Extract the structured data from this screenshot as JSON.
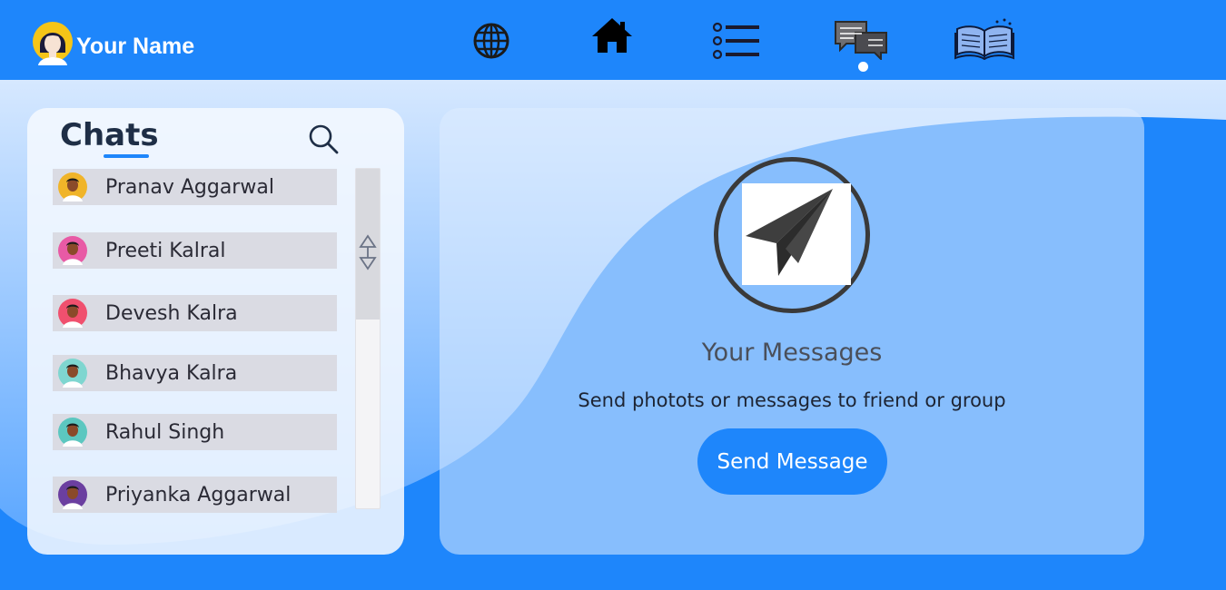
{
  "header": {
    "user_name": "Your Name",
    "nav": [
      {
        "icon": "globe-icon"
      },
      {
        "icon": "home-icon"
      },
      {
        "icon": "list-icon"
      },
      {
        "icon": "chat-bubbles-icon",
        "active": true
      },
      {
        "icon": "book-icon"
      }
    ]
  },
  "chats": {
    "title": "Chats",
    "search_icon": "search-icon",
    "items": [
      {
        "name": "Pranav Aggarwal",
        "avatar_color": "#f0b429"
      },
      {
        "name": "Preeti Kalral",
        "avatar_color": "#e85aa5"
      },
      {
        "name": "Devesh Kalra",
        "avatar_color": "#f0506e"
      },
      {
        "name": "Bhavya Kalra",
        "avatar_color": "#7fd6d0"
      },
      {
        "name": "Rahul Singh",
        "avatar_color": "#5cc7c0"
      },
      {
        "name": "Priyanka Aggarwal",
        "avatar_color": "#6b3fa0"
      }
    ]
  },
  "messages": {
    "icon": "paper-plane-icon",
    "title": "Your Messages",
    "subtitle": "Send photots or messages to friend or group",
    "button_label": "Send Message"
  },
  "colors": {
    "accent": "#1e86fb",
    "panel": "#f4f8ff",
    "text_dark": "#1e2e46"
  }
}
